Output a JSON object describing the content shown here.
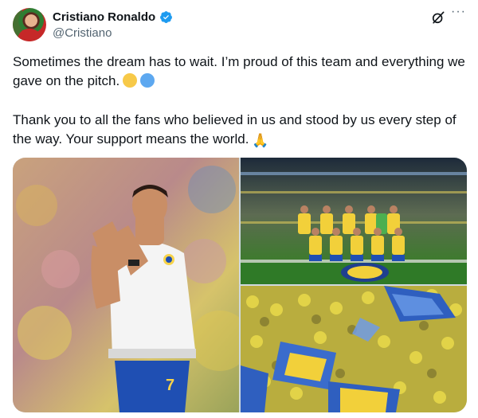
{
  "author": {
    "name": "Cristiano Ronaldo",
    "handle": "@Cristiano",
    "verified": true
  },
  "actions": {
    "grok_icon": "grok-icon",
    "more_icon": "more-options-icon",
    "more_label": "···"
  },
  "tweet": {
    "paragraph1": "Sometimes the dream has to wait. I’m proud of this team and everything we gave on the pitch.",
    "paragraph2": "Thank you to all the fans who believed in us and stood by us every step of the way. Your support means the world.",
    "emoji1_colors": [
      "#f7c948",
      "#5da8f0"
    ],
    "emoji2": "🙏"
  },
  "media": {
    "images": [
      {
        "name": "player-applauding-photo",
        "shirt_number": "7"
      },
      {
        "name": "team-lineup-photo"
      },
      {
        "name": "fans-with-flags-photo"
      }
    ]
  },
  "colors": {
    "accent": "#1d9bf0",
    "text": "#0f1419",
    "secondary": "#536471"
  }
}
